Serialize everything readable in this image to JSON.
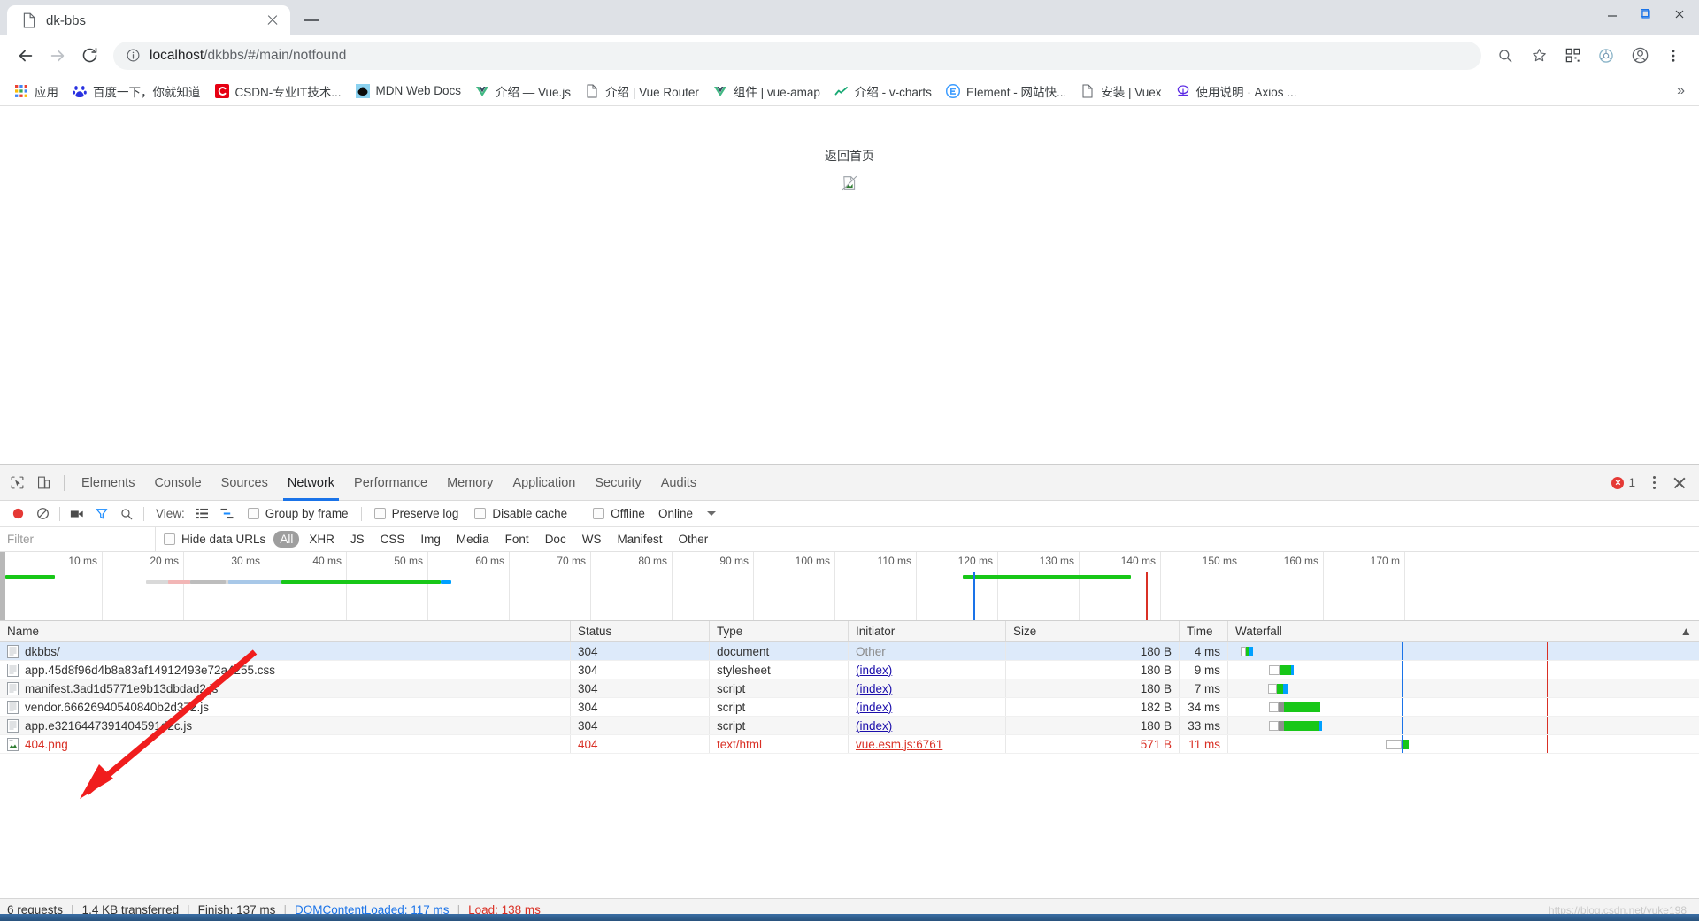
{
  "window": {
    "controls": [
      "minimize",
      "maximize",
      "close"
    ]
  },
  "tab": {
    "title": "dk-bbs",
    "favicon": "document-icon",
    "close_label": "×",
    "new_tab_label": "+"
  },
  "toolbar": {
    "back_label": "Back",
    "forward_label": "Forward",
    "reload_label": "Reload",
    "site_info_label": "View site information",
    "url_host": "localhost",
    "url_path": "/dkbbs/#/main/notfound",
    "url_full": "localhost/dkbbs/#/main/notfound",
    "search_icon": "search-icon",
    "star_icon": "star-icon",
    "qr_icon": "qr-code-icon",
    "ext_icon": "extension-icon",
    "profile_icon": "account-icon",
    "menu_icon": "kebab-menu-icon"
  },
  "bookmarks": {
    "overflow_label": "»",
    "items": [
      {
        "label": "应用",
        "icon": "apps-grid-icon"
      },
      {
        "label": "百度一下，你就知道",
        "icon": "baidu-icon"
      },
      {
        "label": "CSDN-专业IT技术...",
        "icon": "csdn-icon"
      },
      {
        "label": "MDN Web Docs",
        "icon": "mdn-icon"
      },
      {
        "label": "介绍 — Vue.js",
        "icon": "vue-icon"
      },
      {
        "label": "介绍 | Vue Router",
        "icon": "document-icon"
      },
      {
        "label": "组件 | vue-amap",
        "icon": "vue-icon"
      },
      {
        "label": "介绍 - v-charts",
        "icon": "chart-icon"
      },
      {
        "label": "Element - 网站快...",
        "icon": "element-icon"
      },
      {
        "label": "安装 | Vuex",
        "icon": "document-icon"
      },
      {
        "label": "使用说明 · Axios ...",
        "icon": "axios-icon"
      }
    ]
  },
  "page": {
    "back_home_label": "返回首页",
    "broken_image_alt": "broken-image"
  },
  "devtools": {
    "inspect_icon": "inspect-element-icon",
    "device_icon": "device-toolbar-icon",
    "tabs": [
      {
        "label": "Elements",
        "active": false
      },
      {
        "label": "Console",
        "active": false
      },
      {
        "label": "Sources",
        "active": false
      },
      {
        "label": "Network",
        "active": true
      },
      {
        "label": "Performance",
        "active": false
      },
      {
        "label": "Memory",
        "active": false
      },
      {
        "label": "Application",
        "active": false
      },
      {
        "label": "Security",
        "active": false
      },
      {
        "label": "Audits",
        "active": false
      }
    ],
    "error_count": "1",
    "more_label": "⋮",
    "close_label": "×",
    "network_toolbar": {
      "record_icon": "record-button-icon",
      "clear_icon": "clear-icon",
      "camera_icon": "screenshot-camera-icon",
      "filter_icon": "filter-funnel-icon",
      "search_icon": "search-icon",
      "view_label": "View:",
      "view_list_icon": "list-view-icon",
      "view_waterfall_icon": "waterfall-view-icon",
      "group_by_frame_label": "Group by frame",
      "preserve_log_label": "Preserve log",
      "disable_cache_label": "Disable cache",
      "offline_label": "Offline",
      "throttling_label": "Online"
    },
    "filter_bar": {
      "filter_placeholder": "Filter",
      "filter_value": "",
      "hide_data_urls_label": "Hide data URLs",
      "types": [
        "All",
        "XHR",
        "JS",
        "CSS",
        "Img",
        "Media",
        "Font",
        "Doc",
        "WS",
        "Manifest",
        "Other"
      ],
      "active_type": "All"
    },
    "overview": {
      "ticks": [
        "10 ms",
        "20 ms",
        "30 ms",
        "40 ms",
        "50 ms",
        "60 ms",
        "70 ms",
        "80 ms",
        "90 ms",
        "100 ms",
        "110 ms",
        "120 ms",
        "130 ms",
        "140 ms",
        "150 ms",
        "160 ms",
        "170 m"
      ],
      "dom_content_loaded_color": "#1a73e8",
      "load_color": "#d93025"
    },
    "table": {
      "columns": [
        "Name",
        "Status",
        "Type",
        "Initiator",
        "Size",
        "Time",
        "Waterfall"
      ],
      "sort_indicator": "▲",
      "rows": [
        {
          "name": "dkbbs/",
          "status": "304",
          "type": "document",
          "initiator": "Other",
          "initiator_link": false,
          "size": "180 B",
          "time": "4 ms",
          "error": false,
          "selected": true
        },
        {
          "name": "app.45d8f96d4b8a83af14912493e72a4255.css",
          "status": "304",
          "type": "stylesheet",
          "initiator": "(index)",
          "initiator_link": true,
          "size": "180 B",
          "time": "9 ms",
          "error": false,
          "selected": false
        },
        {
          "name": "manifest.3ad1d5771e9b13dbdad2.js",
          "status": "304",
          "type": "script",
          "initiator": "(index)",
          "initiator_link": true,
          "size": "180 B",
          "time": "7 ms",
          "error": false,
          "selected": false
        },
        {
          "name": "vendor.66626940540840b2d372.js",
          "status": "304",
          "type": "script",
          "initiator": "(index)",
          "initiator_link": true,
          "size": "182 B",
          "time": "34 ms",
          "error": false,
          "selected": false
        },
        {
          "name": "app.e3216447391404591d2c.js",
          "status": "304",
          "type": "script",
          "initiator": "(index)",
          "initiator_link": true,
          "size": "180 B",
          "time": "33 ms",
          "error": false,
          "selected": false
        },
        {
          "name": "404.png",
          "status": "404",
          "type": "text/html",
          "initiator": "vue.esm.js:6761",
          "initiator_link": true,
          "size": "571 B",
          "time": "11 ms",
          "error": true,
          "selected": false
        }
      ]
    },
    "status_bar": {
      "requests": "6 requests",
      "transferred": "1.4 KB transferred",
      "finish": "Finish: 137 ms",
      "dom_content_loaded": "DOMContentLoaded: 117 ms",
      "load": "Load: 138 ms",
      "separator": "|"
    }
  },
  "watermark": {
    "text": "https://blog.csdn.net/yuke198"
  },
  "colors": {
    "accent": "#1a73e8",
    "error": "#d93025",
    "waterfall_green": "#18c718",
    "waterfall_blue": "#00a0ff",
    "selection": "#ddeafa"
  }
}
